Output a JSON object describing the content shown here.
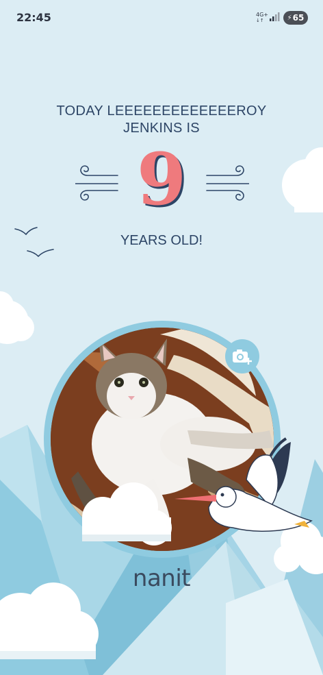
{
  "status_bar": {
    "time": "22:45",
    "network": "4G+",
    "battery_level": "65"
  },
  "milestone": {
    "headline_line1": "TODAY LEEEEEEEEEEEEEROY",
    "headline_line2": "JENKINS IS",
    "age_number": "9",
    "unit_text": "YEARS OLD!"
  },
  "brand": {
    "logo_text": "nanit"
  },
  "icons": {
    "camera": "camera-plus-icon",
    "signal": "signal-icon",
    "battery": "battery-charging-icon"
  },
  "colors": {
    "background": "#dcedf4",
    "number": "#ef7a7d",
    "text": "#2d4566",
    "frame": "#8fcbe0"
  }
}
